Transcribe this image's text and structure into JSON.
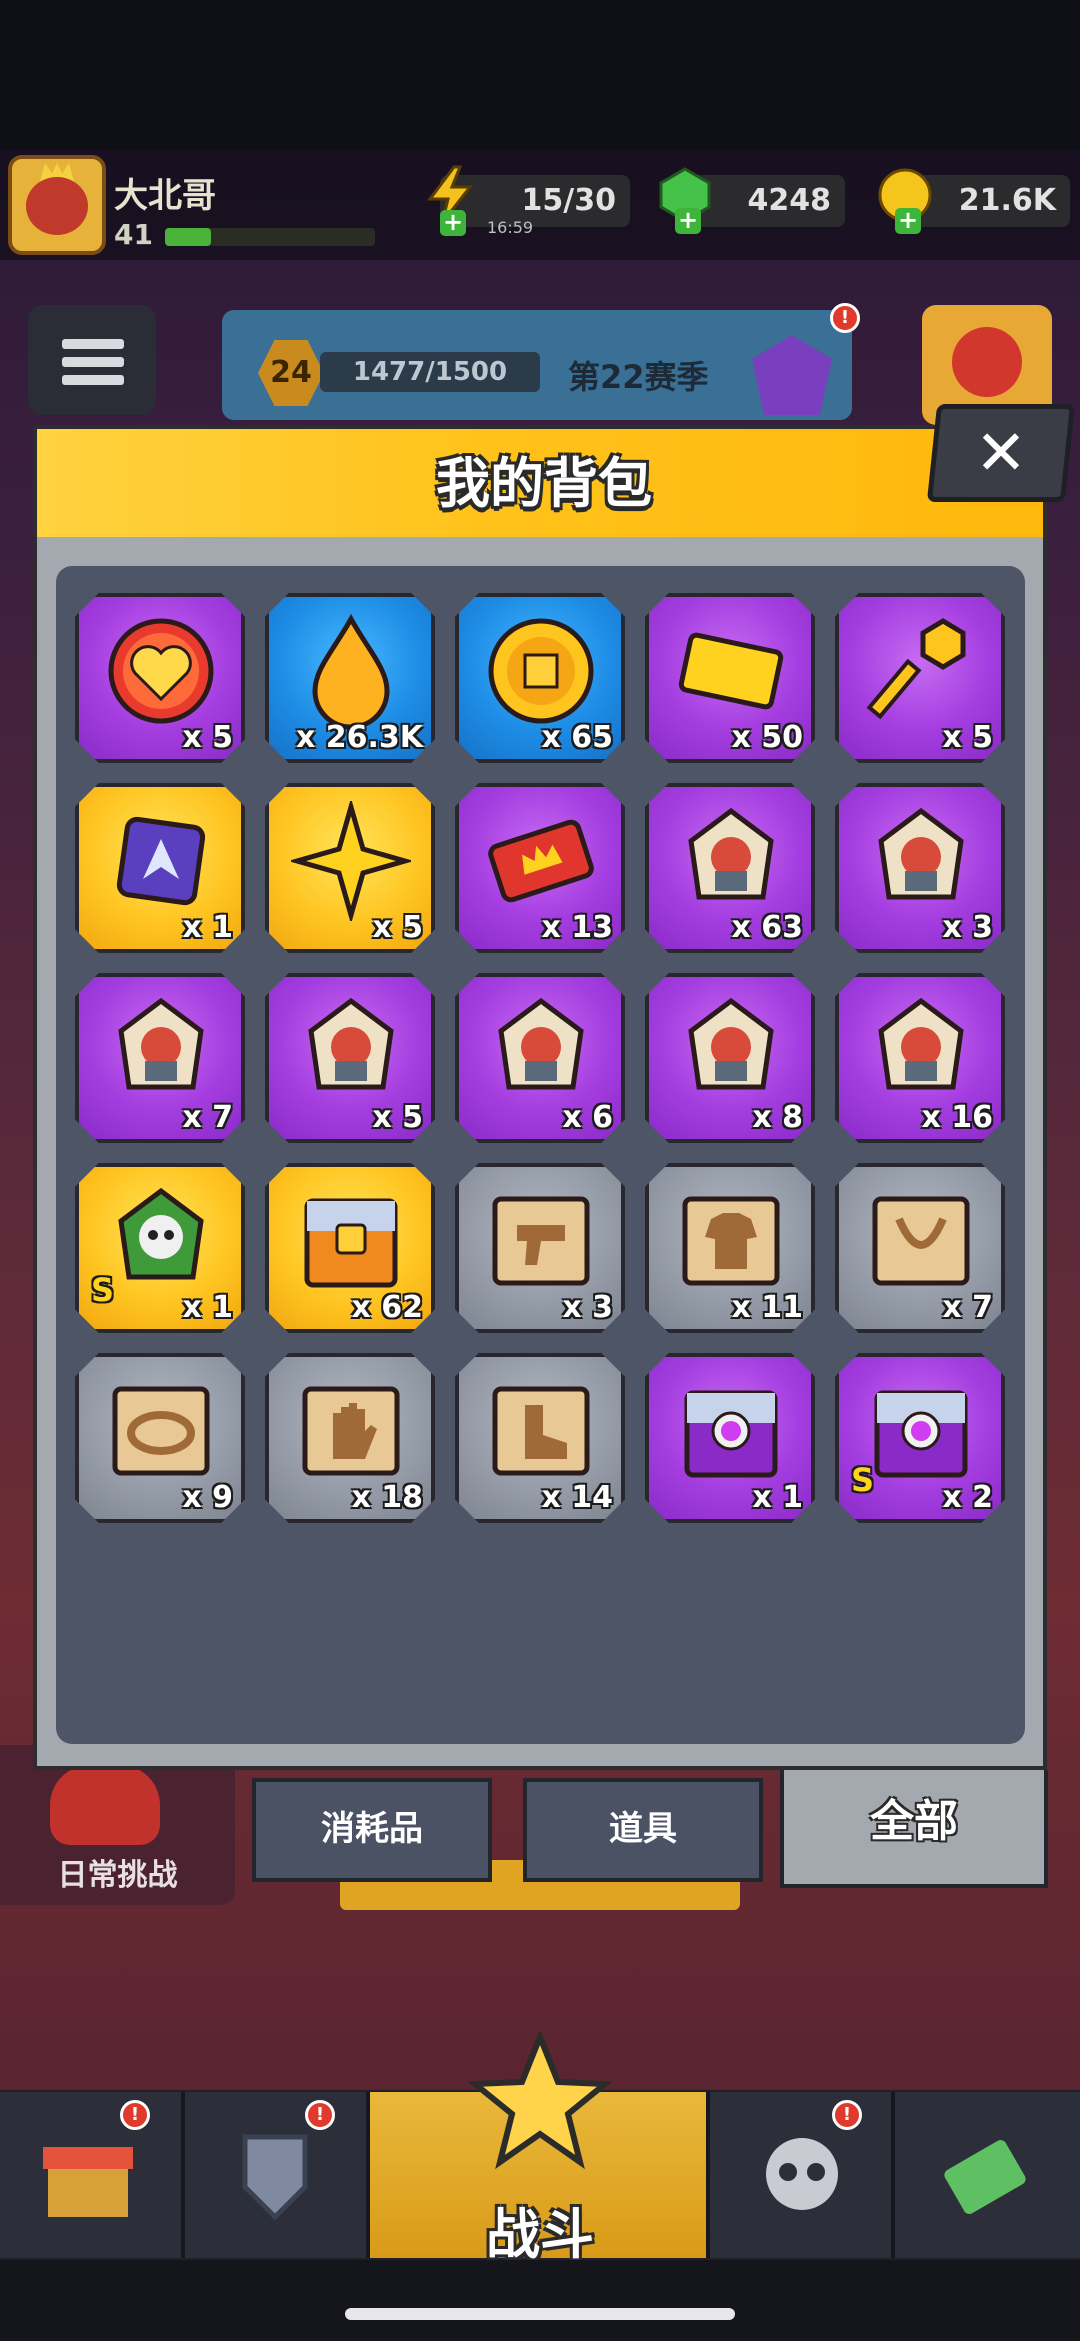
{
  "player": {
    "name": "大北哥",
    "level": "41"
  },
  "resources": {
    "energy": {
      "value": "15/30",
      "timer": "16:59"
    },
    "gems": {
      "value": "4248"
    },
    "coins": {
      "value": "21.6K"
    }
  },
  "season": {
    "level": "24",
    "progress": "1477/1500",
    "label": "第22赛季"
  },
  "panel": {
    "title": "我的背包",
    "close_glyph": "✕"
  },
  "items": [
    {
      "icon": "heart-icon",
      "qty": "x 5",
      "rarity": "purple"
    },
    {
      "icon": "flame-drop-icon",
      "qty": "x 26.3K",
      "rarity": "blue"
    },
    {
      "icon": "gold-coin-icon",
      "qty": "x 65",
      "rarity": "blue"
    },
    {
      "icon": "ticket-icon",
      "qty": "x 50",
      "rarity": "purple"
    },
    {
      "icon": "key-icon",
      "qty": "x 5",
      "rarity": "purple"
    },
    {
      "icon": "chip-icon",
      "qty": "x 1",
      "rarity": "gold"
    },
    {
      "icon": "star-icon",
      "qty": "x 5",
      "rarity": "gold"
    },
    {
      "icon": "crown-ticket-icon",
      "qty": "x 13",
      "rarity": "purple"
    },
    {
      "icon": "hero-puzzle-icon",
      "qty": "x 63",
      "rarity": "purple"
    },
    {
      "icon": "hero-puzzle-icon",
      "qty": "x 3",
      "rarity": "purple"
    },
    {
      "icon": "hero-puzzle-icon",
      "qty": "x 7",
      "rarity": "purple"
    },
    {
      "icon": "hero-puzzle-icon",
      "qty": "x 5",
      "rarity": "purple"
    },
    {
      "icon": "hero-puzzle-icon",
      "qty": "x 6",
      "rarity": "purple"
    },
    {
      "icon": "hero-puzzle-icon",
      "qty": "x 8",
      "rarity": "purple"
    },
    {
      "icon": "hero-puzzle-icon",
      "qty": "x 16",
      "rarity": "purple"
    },
    {
      "icon": "skull-puzzle-icon",
      "qty": "x 1",
      "rarity": "gold",
      "badge": "S"
    },
    {
      "icon": "chest-icon",
      "qty": "x 62",
      "rarity": "gold"
    },
    {
      "icon": "weapon-scroll-icon",
      "qty": "x 3",
      "rarity": "gray"
    },
    {
      "icon": "armor-scroll-icon",
      "qty": "x 11",
      "rarity": "gray"
    },
    {
      "icon": "necklace-scroll-icon",
      "qty": "x 7",
      "rarity": "gray"
    },
    {
      "icon": "belt-scroll-icon",
      "qty": "x 9",
      "rarity": "gray"
    },
    {
      "icon": "glove-scroll-icon",
      "qty": "x 18",
      "rarity": "gray"
    },
    {
      "icon": "boot-scroll-icon",
      "qty": "x 14",
      "rarity": "gray"
    },
    {
      "icon": "purple-chest-icon",
      "qty": "x 1",
      "rarity": "purple"
    },
    {
      "icon": "purple-chest-icon",
      "qty": "x 2",
      "rarity": "purple",
      "badge": "S"
    }
  ],
  "tabs": [
    {
      "label": "消耗品",
      "active": false
    },
    {
      "label": "道具",
      "active": false
    },
    {
      "label": "全部",
      "active": true
    }
  ],
  "behind": {
    "daily_challenge": "日常挑战"
  },
  "bottom_nav": {
    "battle": "战斗"
  },
  "colors": {
    "purple": "#a43de0",
    "blue": "#1e8de6",
    "gold": "#ffc623",
    "gray": "#939aa6",
    "header": "#ffc21a",
    "panel": "#a4a9b0",
    "grid": "#4e5566"
  }
}
